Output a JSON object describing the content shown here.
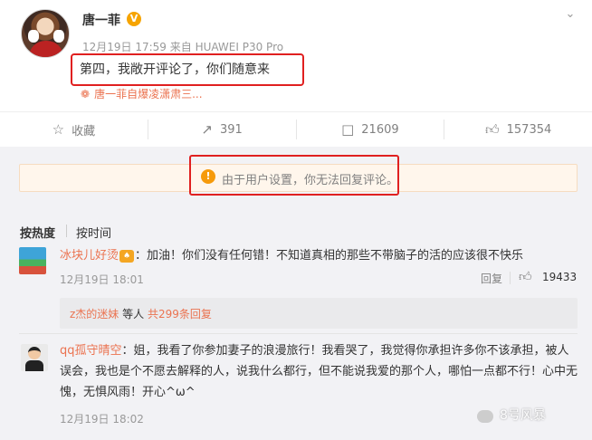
{
  "post": {
    "author": "唐一菲",
    "verified": "V",
    "meta": "12月19日 17:59 来自 HUAWEI P30 Pro",
    "text": "第四，我敞开评论了，你们随意来",
    "source": "唐一菲自爆凌潇肃三..."
  },
  "actions": {
    "favorite": "收藏",
    "repost_count": "391",
    "comment_count": "21609",
    "like_count": "157354"
  },
  "notice": {
    "icon": "!",
    "text": "由于用户设置，你无法回复评论。"
  },
  "sort": {
    "hot": "按热度",
    "time": "按时间"
  },
  "comments": [
    {
      "name": "冰块儿好烫",
      "text": "：加油！你们没有任何错！不知道真相的那些不带脑子的活的应该很不快乐",
      "time": "12月19日 18:01",
      "reply": "回复",
      "likes": "19433",
      "sub_replies": {
        "user": "z杰的迷妹",
        "middle": "等人",
        "link": "共299条回复"
      }
    },
    {
      "name": "qq孤守晴空",
      "text": "：姐，我看了你参加妻子的浪漫旅行！我看哭了，我觉得你承担许多你不该承担，被人误会，我也是个不愿去解释的人，说我什么都行，但不能说我爱的那个人，哪怕一点都不行！心中无愧，无惧风雨！开心^ω^",
      "time": "12月19日 18:02"
    }
  ],
  "watermark": {
    "text": "8号风暴"
  }
}
